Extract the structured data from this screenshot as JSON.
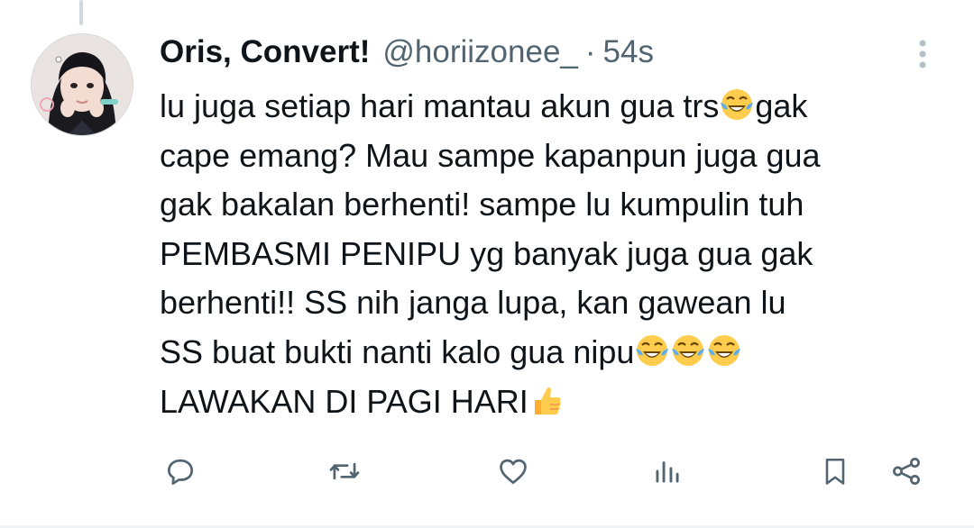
{
  "tweet": {
    "display_name": "Oris, Convert!",
    "handle": "@horiizonee_",
    "separator": "·",
    "time": "54s",
    "text_parts": [
      "lu juga setiap hari mantau akun gua trs",
      "gak\ncape emang? Mau sampe kapanpun juga gua\ngak bakalan berhenti! sampe lu kumpulin tuh\nPEMBASMI PENIPU yg banyak juga gua gak\nberhenti!! SS nih janga lupa, kan gawean lu\nSS buat bukti nanti kalo gua nipu",
      "\nLAWAKAN DI PAGI HARI"
    ],
    "emojis": [
      "face-with-tears-of-joy",
      "thumbs-up"
    ]
  },
  "icons": {
    "more": "more-vertical-icon",
    "reply": "reply-icon",
    "retweet": "retweet-icon",
    "like": "heart-icon",
    "views": "views-icon",
    "bookmark": "bookmark-icon",
    "share": "share-icon"
  },
  "colors": {
    "text": "#0f1419",
    "secondary": "#536471",
    "icon": "#536471",
    "thread_line": "#cfd9de",
    "emoji_yellow": "#ffcc4d",
    "emoji_tear": "#5dadec"
  }
}
